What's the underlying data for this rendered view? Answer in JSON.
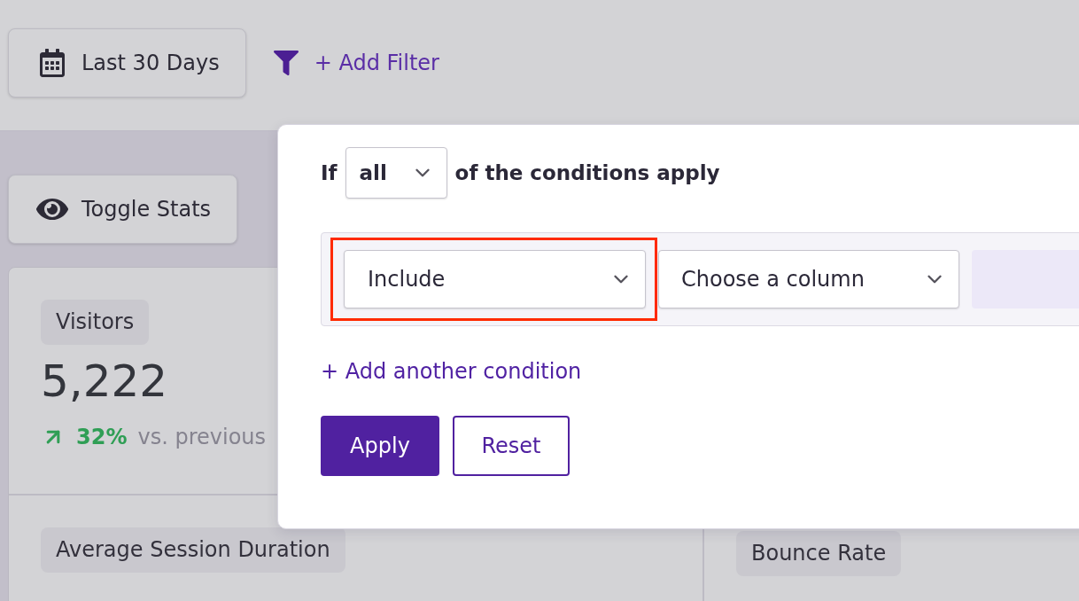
{
  "toolbar": {
    "date_range": {
      "label": "Last 30 Days"
    },
    "add_filter": {
      "label": "+ Add Filter"
    }
  },
  "toggle_stats": {
    "label": "Toggle Stats"
  },
  "stat_rows": [
    {
      "cells": [
        {
          "label": "Visitors",
          "value": "5,222",
          "change": {
            "kind": "increase",
            "percent": "32%",
            "comparison": "vs. previous"
          }
        }
      ]
    },
    {
      "cells": [
        {
          "label": "Average Session Duration"
        },
        {
          "label": "Bounce Rate"
        }
      ]
    }
  ],
  "filter_popover": {
    "prefix": "If",
    "match": {
      "value": "all"
    },
    "suffix": "of the conditions apply",
    "conditions": [
      {
        "mode": {
          "value": "Include",
          "highlighted": true
        },
        "column": {
          "placeholder": "Choose a column"
        },
        "value": {
          "disabled": true
        }
      }
    ],
    "add_condition": "+ Add another condition",
    "buttons": [
      {
        "label": "Apply",
        "kind": "primary"
      },
      {
        "label": "Reset",
        "kind": "secondary"
      }
    ]
  }
}
